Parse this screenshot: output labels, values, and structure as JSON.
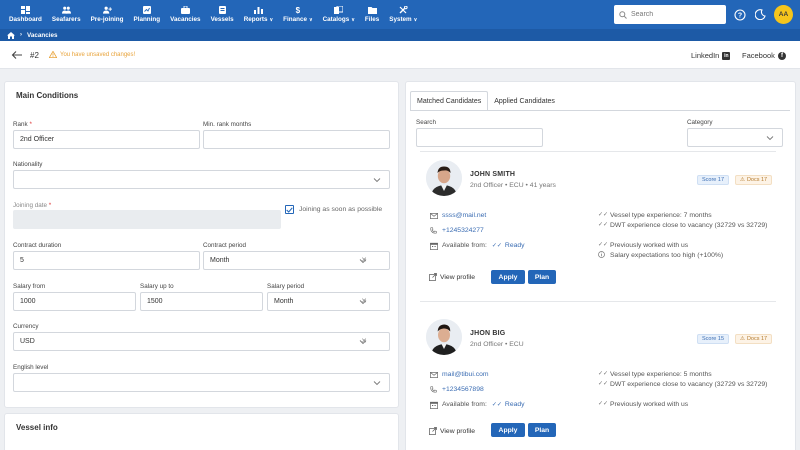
{
  "nav": {
    "items": [
      {
        "label": "Dashboard",
        "icon": "dashboard-icon",
        "dropdown": false
      },
      {
        "label": "Seafarers",
        "icon": "people-icon",
        "dropdown": false
      },
      {
        "label": "Pre-joining",
        "icon": "person-add-icon",
        "dropdown": false
      },
      {
        "label": "Planning",
        "icon": "planning-icon",
        "dropdown": false
      },
      {
        "label": "Vacancies",
        "icon": "briefcase-icon",
        "dropdown": false
      },
      {
        "label": "Vessels",
        "icon": "ship-icon",
        "dropdown": false
      },
      {
        "label": "Reports",
        "icon": "chart-icon",
        "dropdown": true
      },
      {
        "label": "Finance",
        "icon": "dollar-icon",
        "dropdown": true
      },
      {
        "label": "Catalogs",
        "icon": "catalog-icon",
        "dropdown": true
      },
      {
        "label": "Files",
        "icon": "files-icon",
        "dropdown": false
      },
      {
        "label": "System",
        "icon": "tools-icon",
        "dropdown": true
      }
    ],
    "search_placeholder": "Search",
    "avatar_initials": "AA"
  },
  "breadcrumb": {
    "current": "Vacancies"
  },
  "header": {
    "record_id": "#2",
    "warning": "You have unsaved changes!",
    "linkedin": "LinkedIn",
    "facebook": "Facebook"
  },
  "main_conditions": {
    "title": "Main Conditions",
    "rank_label": "Rank",
    "rank_value": "2nd Officer",
    "min_rank_months_label": "Min. rank months",
    "min_rank_months_value": "",
    "nationality_label": "Nationality",
    "nationality_value": "",
    "joining_date_label": "Joining date",
    "joining_asap_label": "Joining as soon as possible",
    "contract_duration_label": "Contract duration",
    "contract_duration_value": "5",
    "contract_period_label": "Contract period",
    "contract_period_value": "Month",
    "salary_from_label": "Salary from",
    "salary_from_value": "1000",
    "salary_up_to_label": "Salary up to",
    "salary_up_to_value": "1500",
    "salary_period_label": "Salary period",
    "salary_period_value": "Month",
    "currency_label": "Currency",
    "currency_value": "USD",
    "english_level_label": "English level",
    "english_level_value": ""
  },
  "vessel_info": {
    "title": "Vessel info"
  },
  "candidates_panel": {
    "tabs": [
      {
        "label": "Matched Candidates",
        "active": true
      },
      {
        "label": "Applied Candidates",
        "active": false
      }
    ],
    "search_label": "Search",
    "category_label": "Category",
    "view_profile_label": "View profile",
    "apply_label": "Apply",
    "plan_label": "Plan",
    "available_from_label": "Available from:",
    "candidates": [
      {
        "name": "JOHN SMITH",
        "subtitle": "2nd Officer • ECU • 41 years",
        "score": "Score 17",
        "docs": "Docs 17",
        "email": "ssss@mail.net",
        "phone": "+1245324277",
        "availability": "Ready",
        "matches": [
          "Vessel type experience: 7 months",
          "DWT experience close to vacancy (32729 vs 32729)",
          "Previously worked with us",
          "Salary expectations too high (+100%)"
        ]
      },
      {
        "name": "JHON BIG",
        "subtitle": "2nd Officer • ECU",
        "score": "Score 15",
        "docs": "Docs 17",
        "email": "mail@tibui.com",
        "phone": "+1234567898",
        "availability": "Ready",
        "matches": [
          "Vessel type experience: 5 months",
          "DWT experience close to vacancy (32729 vs 32729)",
          "Previously worked with us"
        ]
      }
    ]
  },
  "colors": {
    "primary": "#2366b8",
    "breadcrumb": "#1d5aa6",
    "warning": "#e8a33a",
    "avatar": "#f5c51c",
    "link": "#3b6db3"
  }
}
